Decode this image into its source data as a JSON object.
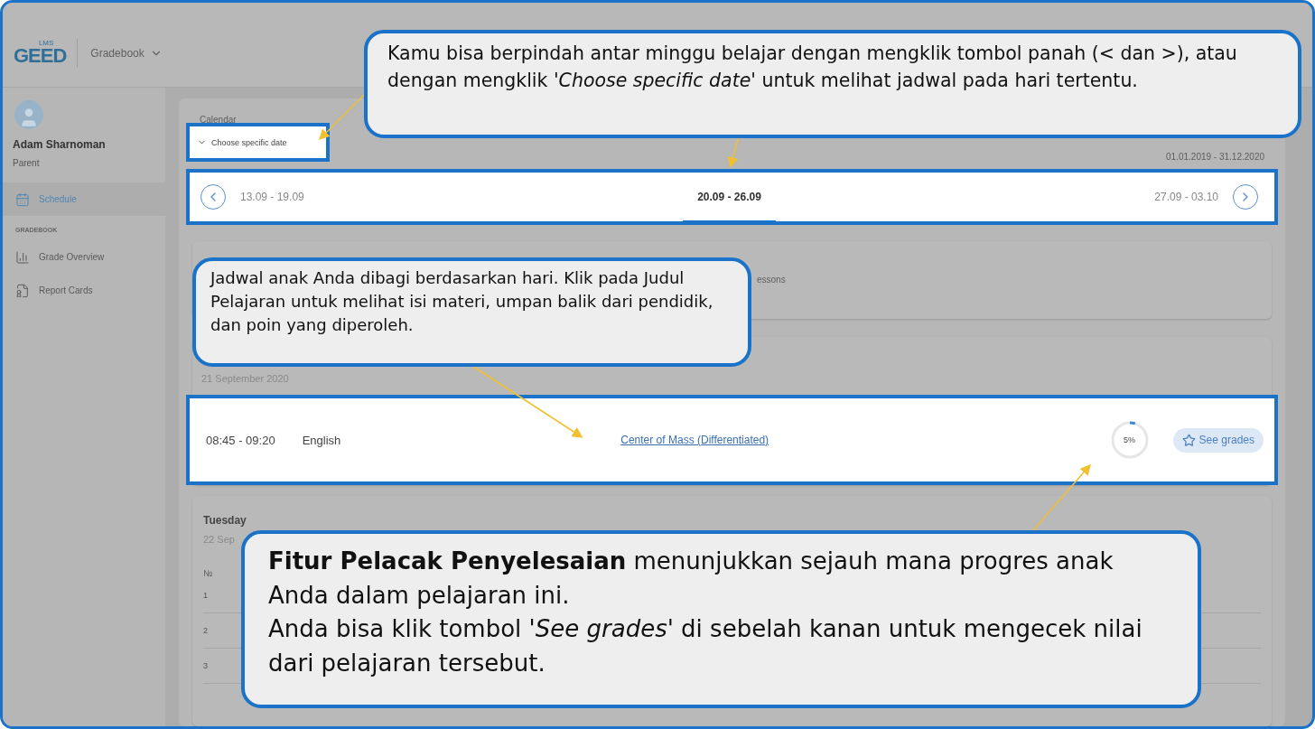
{
  "header": {
    "logo": "GEED",
    "logo_badge": "LMS",
    "menu": "Gradebook"
  },
  "sidebar": {
    "user": {
      "name": "Adam Sharnoman",
      "role": "Parent"
    },
    "items": [
      {
        "label": "Schedule",
        "selected": true
      }
    ],
    "section": "GRADEBOOK",
    "section_items": [
      {
        "label": "Grade Overview",
        "selected": false
      },
      {
        "label": "Report Cards",
        "selected": false
      }
    ]
  },
  "calendar": {
    "label": "Calendar",
    "date_picker": "Choose specific date",
    "range": "01.01.2019 - 31.12.2020",
    "weeks": [
      {
        "label": "13.09 - 19.09",
        "selected": false
      },
      {
        "label": "20.09 - 26.09",
        "selected": true
      },
      {
        "label": "27.09 - 03.10",
        "selected": false
      }
    ]
  },
  "notice": {
    "text_fragment": "essons"
  },
  "days": [
    {
      "date": "21 September 2020",
      "lessons": [
        {
          "time": "08:45 - 09:20",
          "subject": "English",
          "title": "Center of Mass (Differentiated)",
          "progress": {
            "level": 0.05,
            "reading": "5%"
          },
          "button": "See grades"
        }
      ]
    },
    {
      "name": "Tuesday",
      "date_fragment": "22 Sep",
      "column_1": "№",
      "rows": [
        "1",
        "2",
        "3"
      ]
    }
  ],
  "callouts": [
    {
      "paragraphs": [
        "Kamu bisa berpindah antar minggu belajar dengan mengklik tombol panah (< dan >), atau dengan mengklik '*Choose specific date*' untuk melihat jadwal pada hari tertentu."
      ]
    },
    {
      "paragraphs": [
        "Jadwal anak Anda dibagi berdasarkan hari. Klik pada Judul Pelajaran untuk melihat isi materi, umpan balik dari pendidik, dan poin yang diperoleh."
      ]
    },
    {
      "paragraphs": [
        "**Fitur Pelacak Penyelesaian** menunjukkan sejauh mana progres anak Anda dalam pelajaran ini.",
        "Anda bisa klik tombol '*See grades*' di sebelah kanan untuk mengecek nilai dari pelajaran tersebut."
      ]
    }
  ]
}
